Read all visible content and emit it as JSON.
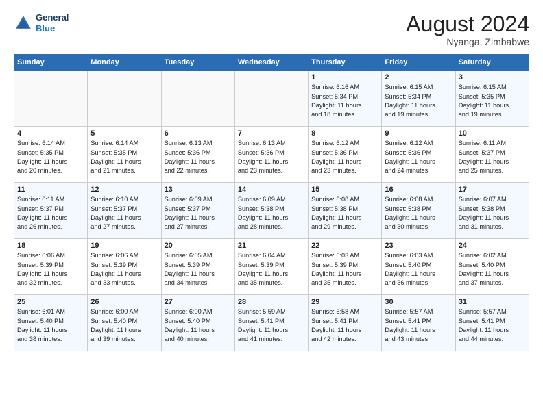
{
  "header": {
    "logo_line1": "General",
    "logo_line2": "Blue",
    "month": "August 2024",
    "location": "Nyanga, Zimbabwe"
  },
  "weekdays": [
    "Sunday",
    "Monday",
    "Tuesday",
    "Wednesday",
    "Thursday",
    "Friday",
    "Saturday"
  ],
  "weeks": [
    [
      {
        "day": "",
        "info": ""
      },
      {
        "day": "",
        "info": ""
      },
      {
        "day": "",
        "info": ""
      },
      {
        "day": "",
        "info": ""
      },
      {
        "day": "1",
        "info": "Sunrise: 6:16 AM\nSunset: 5:34 PM\nDaylight: 11 hours\nand 18 minutes."
      },
      {
        "day": "2",
        "info": "Sunrise: 6:15 AM\nSunset: 5:34 PM\nDaylight: 11 hours\nand 19 minutes."
      },
      {
        "day": "3",
        "info": "Sunrise: 6:15 AM\nSunset: 5:35 PM\nDaylight: 11 hours\nand 19 minutes."
      }
    ],
    [
      {
        "day": "4",
        "info": "Sunrise: 6:14 AM\nSunset: 5:35 PM\nDaylight: 11 hours\nand 20 minutes."
      },
      {
        "day": "5",
        "info": "Sunrise: 6:14 AM\nSunset: 5:35 PM\nDaylight: 11 hours\nand 21 minutes."
      },
      {
        "day": "6",
        "info": "Sunrise: 6:13 AM\nSunset: 5:36 PM\nDaylight: 11 hours\nand 22 minutes."
      },
      {
        "day": "7",
        "info": "Sunrise: 6:13 AM\nSunset: 5:36 PM\nDaylight: 11 hours\nand 23 minutes."
      },
      {
        "day": "8",
        "info": "Sunrise: 6:12 AM\nSunset: 5:36 PM\nDaylight: 11 hours\nand 23 minutes."
      },
      {
        "day": "9",
        "info": "Sunrise: 6:12 AM\nSunset: 5:36 PM\nDaylight: 11 hours\nand 24 minutes."
      },
      {
        "day": "10",
        "info": "Sunrise: 6:11 AM\nSunset: 5:37 PM\nDaylight: 11 hours\nand 25 minutes."
      }
    ],
    [
      {
        "day": "11",
        "info": "Sunrise: 6:11 AM\nSunset: 5:37 PM\nDaylight: 11 hours\nand 26 minutes."
      },
      {
        "day": "12",
        "info": "Sunrise: 6:10 AM\nSunset: 5:37 PM\nDaylight: 11 hours\nand 27 minutes."
      },
      {
        "day": "13",
        "info": "Sunrise: 6:09 AM\nSunset: 5:37 PM\nDaylight: 11 hours\nand 27 minutes."
      },
      {
        "day": "14",
        "info": "Sunrise: 6:09 AM\nSunset: 5:38 PM\nDaylight: 11 hours\nand 28 minutes."
      },
      {
        "day": "15",
        "info": "Sunrise: 6:08 AM\nSunset: 5:38 PM\nDaylight: 11 hours\nand 29 minutes."
      },
      {
        "day": "16",
        "info": "Sunrise: 6:08 AM\nSunset: 5:38 PM\nDaylight: 11 hours\nand 30 minutes."
      },
      {
        "day": "17",
        "info": "Sunrise: 6:07 AM\nSunset: 5:38 PM\nDaylight: 11 hours\nand 31 minutes."
      }
    ],
    [
      {
        "day": "18",
        "info": "Sunrise: 6:06 AM\nSunset: 5:39 PM\nDaylight: 11 hours\nand 32 minutes."
      },
      {
        "day": "19",
        "info": "Sunrise: 6:06 AM\nSunset: 5:39 PM\nDaylight: 11 hours\nand 33 minutes."
      },
      {
        "day": "20",
        "info": "Sunrise: 6:05 AM\nSunset: 5:39 PM\nDaylight: 11 hours\nand 34 minutes."
      },
      {
        "day": "21",
        "info": "Sunrise: 6:04 AM\nSunset: 5:39 PM\nDaylight: 11 hours\nand 35 minutes."
      },
      {
        "day": "22",
        "info": "Sunrise: 6:03 AM\nSunset: 5:39 PM\nDaylight: 11 hours\nand 35 minutes."
      },
      {
        "day": "23",
        "info": "Sunrise: 6:03 AM\nSunset: 5:40 PM\nDaylight: 11 hours\nand 36 minutes."
      },
      {
        "day": "24",
        "info": "Sunrise: 6:02 AM\nSunset: 5:40 PM\nDaylight: 11 hours\nand 37 minutes."
      }
    ],
    [
      {
        "day": "25",
        "info": "Sunrise: 6:01 AM\nSunset: 5:40 PM\nDaylight: 11 hours\nand 38 minutes."
      },
      {
        "day": "26",
        "info": "Sunrise: 6:00 AM\nSunset: 5:40 PM\nDaylight: 11 hours\nand 39 minutes."
      },
      {
        "day": "27",
        "info": "Sunrise: 6:00 AM\nSunset: 5:40 PM\nDaylight: 11 hours\nand 40 minutes."
      },
      {
        "day": "28",
        "info": "Sunrise: 5:59 AM\nSunset: 5:41 PM\nDaylight: 11 hours\nand 41 minutes."
      },
      {
        "day": "29",
        "info": "Sunrise: 5:58 AM\nSunset: 5:41 PM\nDaylight: 11 hours\nand 42 minutes."
      },
      {
        "day": "30",
        "info": "Sunrise: 5:57 AM\nSunset: 5:41 PM\nDaylight: 11 hours\nand 43 minutes."
      },
      {
        "day": "31",
        "info": "Sunrise: 5:57 AM\nSunset: 5:41 PM\nDaylight: 11 hours\nand 44 minutes."
      }
    ]
  ]
}
